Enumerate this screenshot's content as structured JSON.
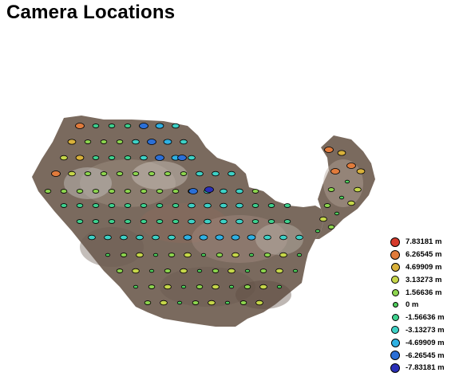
{
  "title": "Camera Locations",
  "legend": [
    {
      "label": "7.83181 m",
      "value": 7.83181,
      "color": "#d63a2b",
      "size": 10
    },
    {
      "label": "6.26545 m",
      "value": 6.26545,
      "color": "#e07b3c",
      "size": 10
    },
    {
      "label": "4.69909 m",
      "value": 4.69909,
      "color": "#d9b13b",
      "size": 9
    },
    {
      "label": "3.13273 m",
      "value": 3.13273,
      "color": "#c6d64a",
      "size": 8
    },
    {
      "label": "1.56636 m",
      "value": 1.56636,
      "color": "#8ed64f",
      "size": 7
    },
    {
      "label": "0 m",
      "value": 0,
      "color": "#4fcf5c",
      "size": 5
    },
    {
      "label": "-1.56636 m",
      "value": -1.56636,
      "color": "#3fd28f",
      "size": 7
    },
    {
      "label": "-3.13273 m",
      "value": -3.13273,
      "color": "#3ed1c6",
      "size": 8
    },
    {
      "label": "-4.69909 m",
      "value": -4.69909,
      "color": "#2fb1e3",
      "size": 9
    },
    {
      "label": "-6.26545 m",
      "value": -6.26545,
      "color": "#2b6fd6",
      "size": 10
    },
    {
      "label": "-7.83181 m",
      "value": -7.83181,
      "color": "#2a2fb7",
      "size": 10
    }
  ]
}
